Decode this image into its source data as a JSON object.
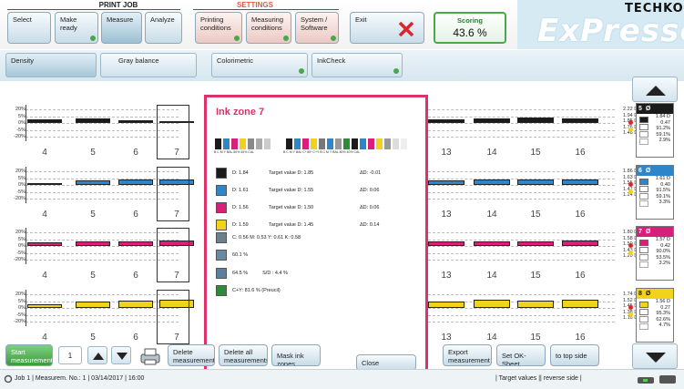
{
  "header": {
    "print_job_label": "PRINT JOB",
    "settings_label": "SETTINGS",
    "buttons": {
      "select": "Select",
      "make_ready": "Make ready",
      "measure": "Measure",
      "analyze": "Analyze",
      "printing_conditions": "Printing conditions",
      "measuring_conditions": "Measuring conditions",
      "system_software": "System / Software",
      "exit": "Exit"
    },
    "scoring_label": "Scoring",
    "scoring_value": "43.6 %",
    "logo_brand": "TECHKON",
    "logo_product": "ExPresso"
  },
  "tabs": [
    "Density",
    "Gray balance",
    "Colorimetric",
    "InkCheck"
  ],
  "y_ticks": [
    "20%",
    "5%",
    "0%",
    "-5%",
    "-20%"
  ],
  "zones_left": [
    "4",
    "5",
    "6",
    "7"
  ],
  "zones_right": [
    "13",
    "14",
    "15",
    "16"
  ],
  "rows": [
    {
      "name": "K",
      "color": "#1b1b1b",
      "values": [
        "2.22 D",
        "1.94 D",
        "1.85 D",
        "1.76 D",
        "1.48 D"
      ],
      "box_num": "5",
      "avg": "Ø",
      "stats": [
        "1.84 D",
        "0.47",
        "91.2%",
        "59.1%",
        "2.9%"
      ]
    },
    {
      "name": "C",
      "color": "#2e86c8",
      "values": [
        "1.86 D",
        "1.63 D",
        "1.55 D",
        "1.47 D",
        "1.24 D"
      ],
      "box_num": "6",
      "avg": "Ø",
      "stats": [
        "1.61 D",
        "0.40",
        "91.5%",
        "59.1%",
        "3.3%"
      ]
    },
    {
      "name": "M",
      "color": "#d8207a",
      "values": [
        "1.80 D",
        "1.58 D",
        "1.50 D",
        "1.43 D",
        "1.20 D"
      ],
      "box_num": "7",
      "avg": "Ø",
      "stats": [
        "1.57 D",
        "0.42",
        "90.0%",
        "53.5%",
        "3.2%"
      ]
    },
    {
      "name": "Y",
      "color": "#f2d21a",
      "values": [
        "1.74 D",
        "1.52 D",
        "1.45 D",
        "1.38 D",
        "1.16 D"
      ],
      "box_num": "8",
      "avg": "Ø",
      "stats": [
        "1.56 D",
        "0.27",
        "95.3%",
        "62.6%",
        "4.7%"
      ]
    }
  ],
  "popup": {
    "title": "Ink zone 7",
    "strip_labels_1": "B C M Y BAL 80% 40% CAL",
    "strip_labels_2": "B C M Y BAL C* 80* C+Y B C M Y BAL 80% 40% CAL",
    "lines": [
      {
        "color": "#1b1b1b",
        "d": "D: 1.84",
        "target": "Target value D: 1.85",
        "delta": "ΔD: -0.01"
      },
      {
        "color": "#2e86c8",
        "d": "D: 1.61",
        "target": "Target value D: 1.55",
        "delta": "ΔD: 0.06"
      },
      {
        "color": "#d8207a",
        "d": "D: 1.56",
        "target": "Target value D: 1.50",
        "delta": "ΔD: 0.06"
      },
      {
        "color": "#f2d21a",
        "d": "D: 1.59",
        "target": "Target value D: 1.45",
        "delta": "ΔD: 0.14"
      }
    ],
    "cmyk_line": "C: 0.56  M: 0.53  Y: 0.61  K: 0.58",
    "pct_line": "60.1 %",
    "sd_line1": "64.5 %",
    "sd_line2": "S/D : 4.4 %",
    "cy_line": "C+Y: 81.6 % (Preucil)",
    "close": "Close"
  },
  "bottom": {
    "start": "Start measurement",
    "counter": "1",
    "delete": "Delete measurement",
    "delete_all": "Delete all measurements",
    "mask": "Mask ink zones",
    "export": "Export measurement",
    "set_ok": "Set OK-Sheet",
    "to_top": "to top side",
    "status_left": "Job 1  |  Measurem. No.: 1  |  03/14/2017  |  16:00",
    "status_right": "|  Target values  ||  reverse side  |"
  }
}
